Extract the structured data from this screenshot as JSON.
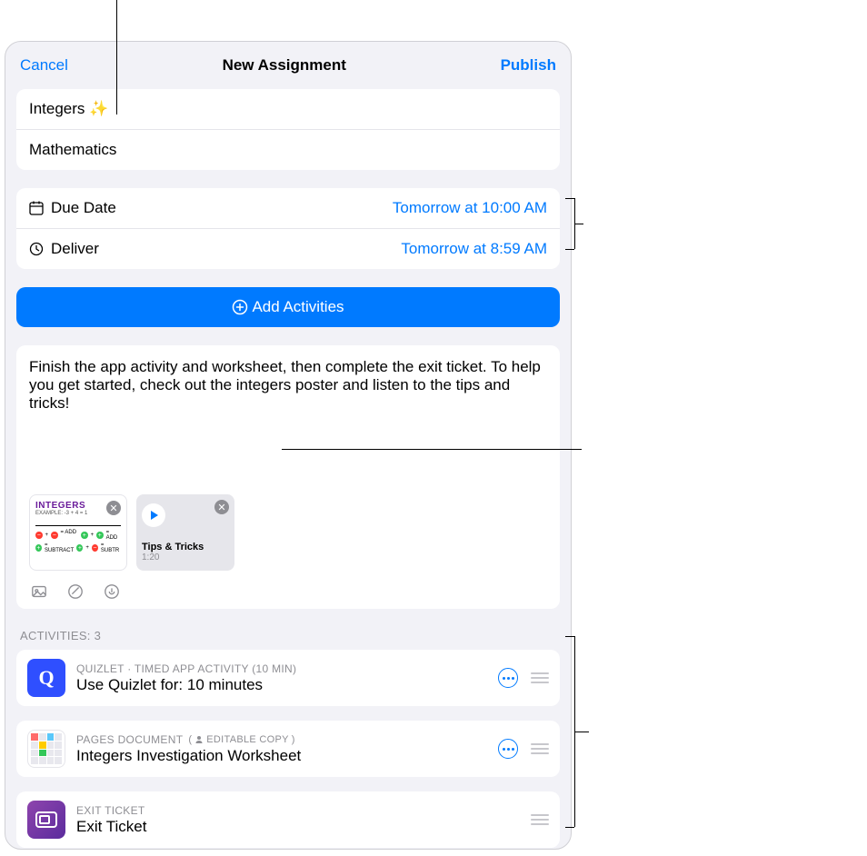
{
  "header": {
    "cancel": "Cancel",
    "title": "New Assignment",
    "publish": "Publish"
  },
  "assignment": {
    "title": "Integers ✨",
    "class": "Mathematics"
  },
  "schedule": {
    "due_label": "Due Date",
    "due_value": "Tomorrow at 10:00 AM",
    "deliver_label": "Deliver",
    "deliver_value": "Tomorrow at 8:59 AM"
  },
  "add_activities_label": "Add Activities",
  "description": "Finish the app activity and worksheet, then complete the exit ticket. To help you get started, check out the integers poster and listen to the tips and tricks!",
  "attachments": {
    "poster": {
      "title": "INTEGERS"
    },
    "audio": {
      "title": "Tips & Tricks",
      "duration": "1:20"
    }
  },
  "activities_header": "ACTIVITIES: 3",
  "activities": [
    {
      "kicker": "QUIZLET · TIMED APP ACTIVITY (10 MIN)",
      "name": "Use Quizlet for: 10 minutes",
      "has_more": true
    },
    {
      "kicker": "PAGES DOCUMENT",
      "badge": "EDITABLE COPY",
      "name": "Integers Investigation Worksheet",
      "has_more": true
    },
    {
      "kicker": "EXIT TICKET",
      "name": "Exit Ticket",
      "has_more": false
    }
  ]
}
